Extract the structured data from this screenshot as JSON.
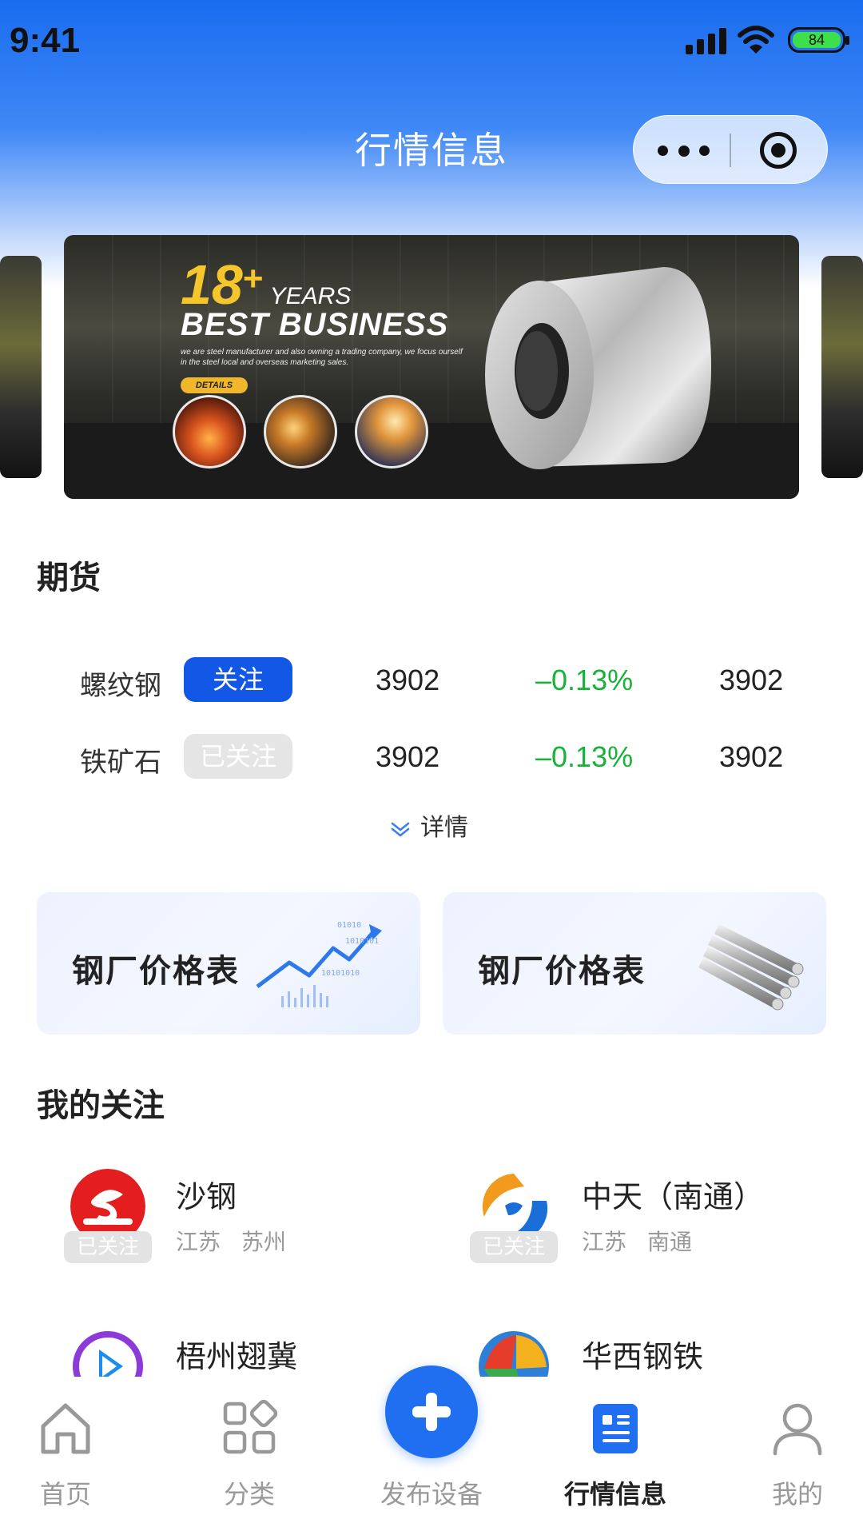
{
  "status_bar": {
    "time": "9:41",
    "battery": "84"
  },
  "nav": {
    "title": "行情信息"
  },
  "banner": {
    "number": "18",
    "plus": "+",
    "years": "YEARS",
    "title": "BEST BUSINESS",
    "subtitle": "we are steel manufacturer and also owning a trading company, we focus ourself in the steel local and overseas marketing sales.",
    "button": "DETAILS"
  },
  "futures": {
    "title": "期货",
    "rows": [
      {
        "name": "螺纹钢",
        "badge": "关注",
        "price": "3902",
        "change": "–0.13%",
        "last": "3902"
      },
      {
        "name": "铁矿石",
        "badge": "已关注",
        "price": "3902",
        "change": "–0.13%",
        "last": "3902"
      }
    ],
    "detail_label": "详情"
  },
  "price_cards": [
    {
      "label": "钢厂价格表",
      "deco": "chart-deco-icon"
    },
    {
      "label": "钢厂价格表",
      "deco": "steel-bars-icon"
    }
  ],
  "my_follow": {
    "title": "我的关注",
    "items": [
      {
        "name": "沙钢",
        "province": "江苏",
        "city": "苏州",
        "badge": "已关注"
      },
      {
        "name": "中天（南通）",
        "province": "江苏",
        "city": "南通",
        "badge": "已关注"
      },
      {
        "name": "梧州翅冀"
      },
      {
        "name": "华西钢铁"
      }
    ]
  },
  "tabbar": {
    "items": [
      {
        "label": "首页",
        "icon": "home-icon"
      },
      {
        "label": "分类",
        "icon": "category-icon"
      },
      {
        "label": "发布设备",
        "icon": "plus-icon"
      },
      {
        "label": "行情信息",
        "icon": "news-icon",
        "active": true
      },
      {
        "label": "我的",
        "icon": "user-icon"
      }
    ]
  },
  "colors": {
    "primary": "#1257e6",
    "rise_fall_green": "#17b238",
    "badge_followed": "#e5e5e5"
  }
}
